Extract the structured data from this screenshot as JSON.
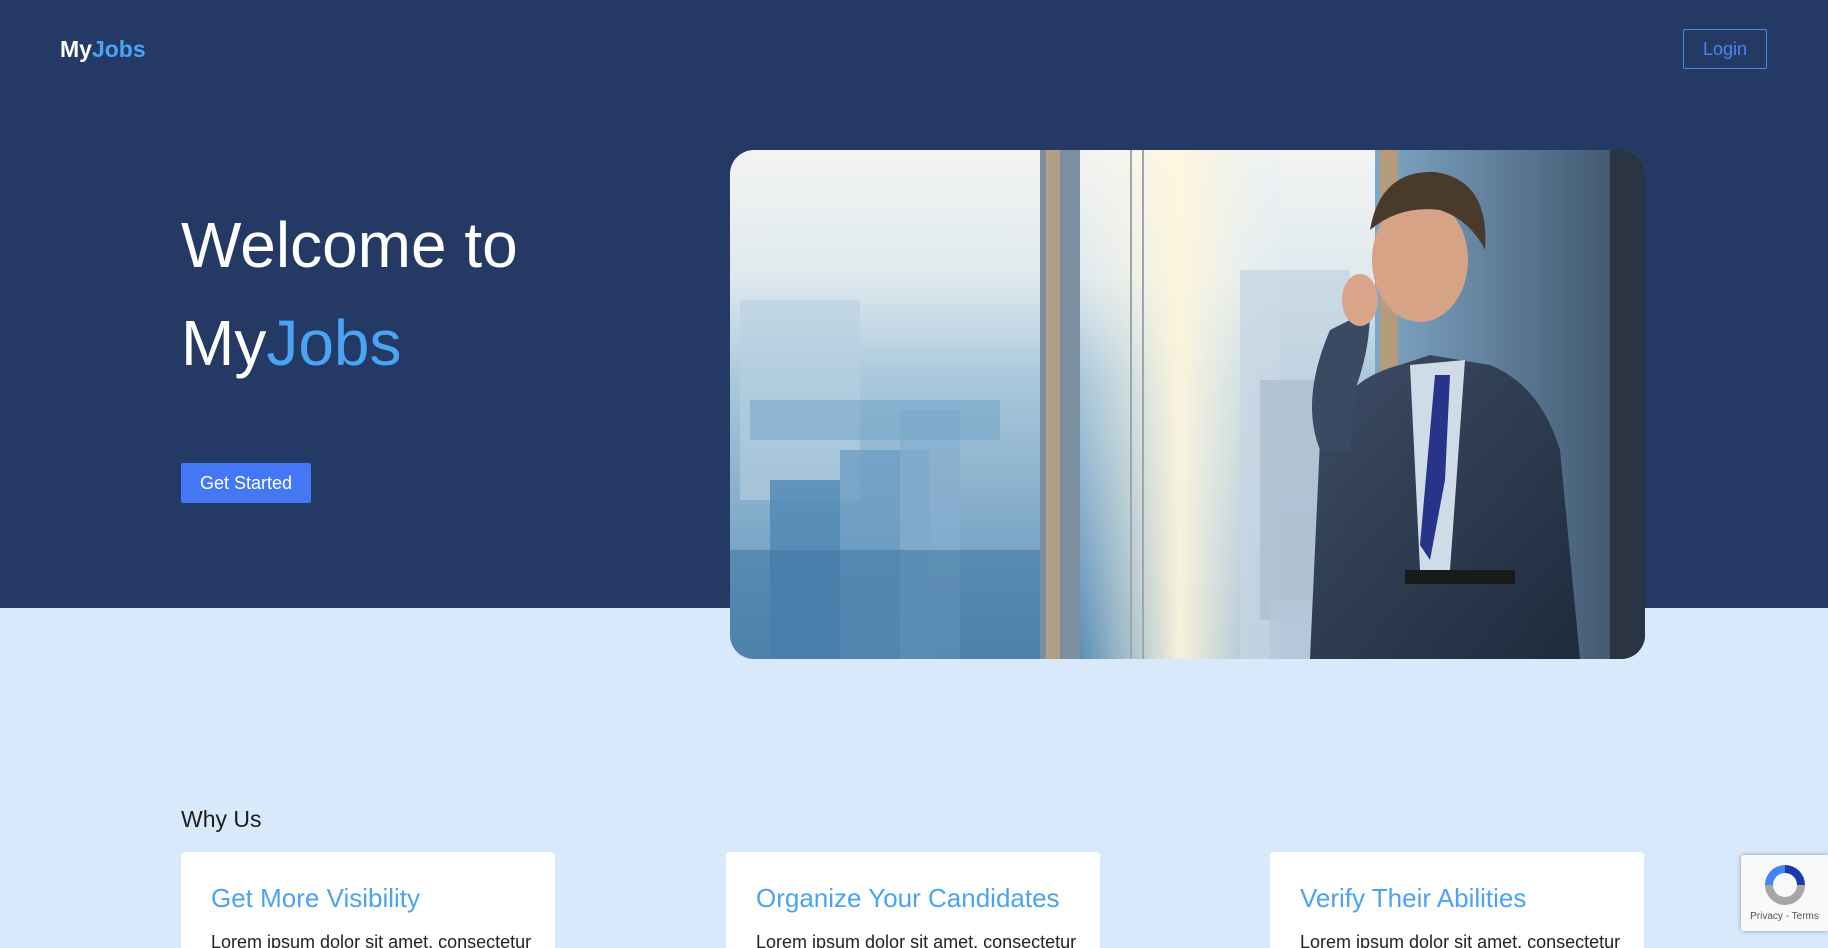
{
  "header": {
    "logo_part1": "My",
    "logo_part2": "Jobs",
    "login_label": "Login"
  },
  "hero": {
    "title_line1": "Welcome to",
    "title_my": "My",
    "title_jobs": "Jobs",
    "cta_label": "Get Started"
  },
  "why_us": {
    "title": "Why Us",
    "cards": [
      {
        "title": "Get More Visibility",
        "text": "Lorem ipsum dolor sit amet, consectetur"
      },
      {
        "title": "Organize Your Candidates",
        "text": "Lorem ipsum dolor sit amet, consectetur"
      },
      {
        "title": "Verify Their Abilities",
        "text": "Lorem ipsum dolor sit amet, consectetur"
      }
    ]
  },
  "recaptcha": {
    "icon": "recaptcha-icon",
    "links": "Privacy - Terms"
  },
  "colors": {
    "hero_bg": "#243a65",
    "page_bg": "#d9e9fc",
    "accent": "#4aa3f5",
    "button": "#4477f5"
  }
}
